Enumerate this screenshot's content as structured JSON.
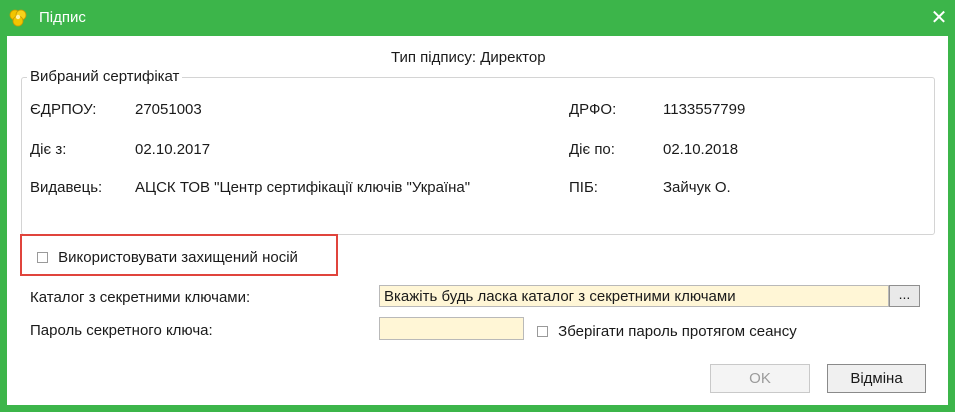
{
  "window": {
    "title": "Підпис",
    "close_glyph": "✕",
    "icon": "yellow-flower-icon"
  },
  "signature_type": "Тип підпису: Директор",
  "certificate": {
    "legend": "Вибраний сертифікат",
    "edrpou_label": "ЄДРПОУ:",
    "edrpou_value": "27051003",
    "drfo_label": "ДРФО:",
    "drfo_value": "1133557799",
    "valid_from_label": "Діє з:",
    "valid_from_value": "02.10.2017",
    "valid_to_label": "Діє по:",
    "valid_to_value": "02.10.2018",
    "issuer_label": "Видавець:",
    "issuer_value": "АЦСК ТОВ \"Центр сертифікації ключів \"Україна\"",
    "pib_label": "ПІБ:",
    "pib_value": "Зайчук О."
  },
  "protected_media": {
    "label": "Використовувати захищений носій",
    "checked": false
  },
  "key_dir": {
    "label": "Каталог з секретними ключами:",
    "value": "Вкажіть будь ласка каталог з секретними ключами",
    "browse_label": "..."
  },
  "password": {
    "label": "Пароль секретного ключа:",
    "value": "",
    "remember_label": "Зберігати пароль протягом сеансу",
    "remember_checked": false
  },
  "buttons": {
    "ok": "OK",
    "cancel": "Відміна"
  },
  "colors": {
    "frame": "#3cb54a",
    "highlight": "#e0443c",
    "input_bg": "#fff6d6"
  }
}
